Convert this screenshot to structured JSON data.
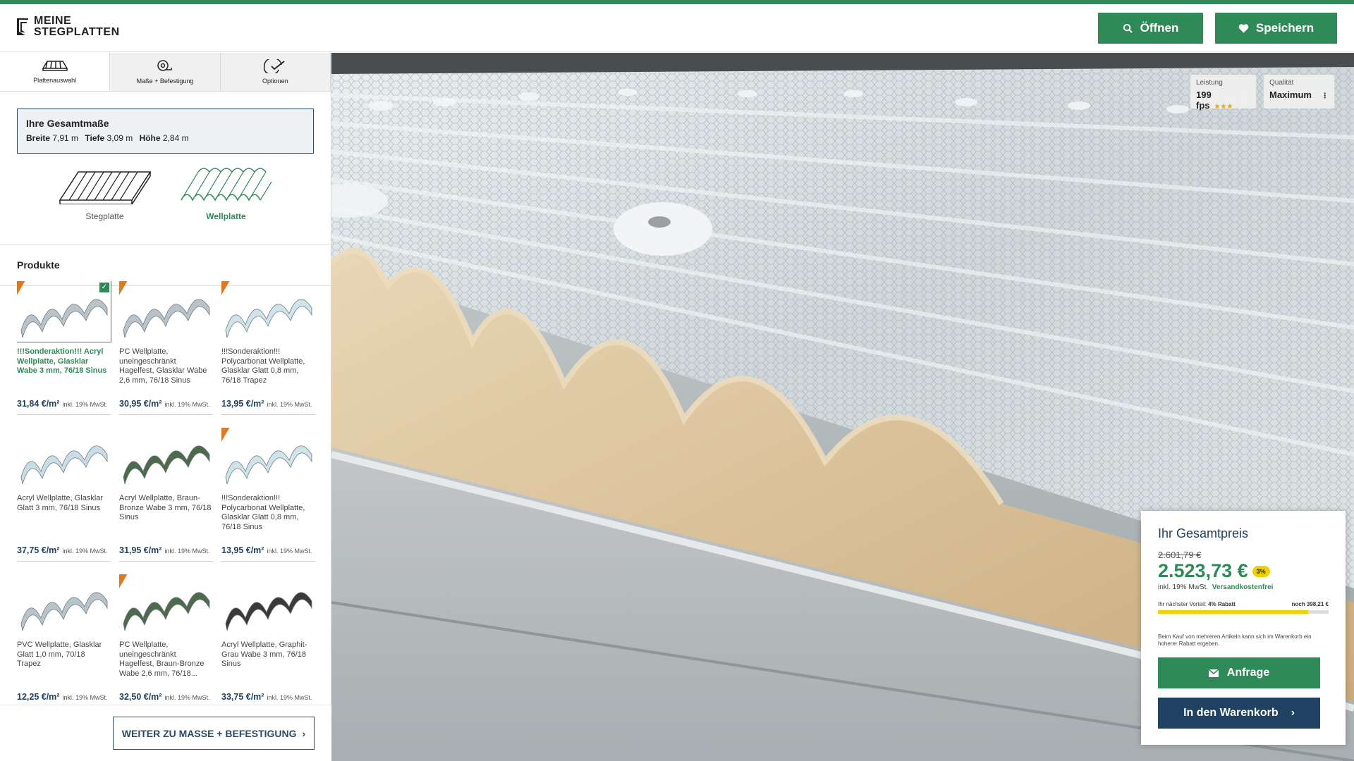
{
  "brand": {
    "line1": "MEINE",
    "line2": "STEGPLATTEN",
    "accent": "#2e8b57",
    "navy": "#1f4262"
  },
  "header": {
    "open_label": "Öffnen",
    "save_label": "Speichern"
  },
  "tabs": [
    {
      "label": "Plattenauswahl",
      "icon": "roof-panel-icon",
      "active": true
    },
    {
      "label": "Maße + Befestigung",
      "icon": "tape-measure-icon",
      "active": false
    },
    {
      "label": "Optionen",
      "icon": "options-check-icon",
      "active": false
    }
  ],
  "dims": {
    "title": "Ihre Gesamtmaße",
    "width_label": "Breite",
    "width_value": "7,91 m",
    "depth_label": "Tiefe",
    "depth_value": "3,09 m",
    "height_label": "Höhe",
    "height_value": "2,84 m"
  },
  "types": [
    {
      "label": "Stegplatte",
      "active": false
    },
    {
      "label": "Wellplatte",
      "active": true
    }
  ],
  "products_title": "Produkte",
  "vat_small": "inkl. 19% MwSt.",
  "products": [
    {
      "name": "!!!Sonderaktion!!! Acryl Wellplatte, Glasklar Wabe 3 mm, 76/18 Sinus",
      "price": "31,84 €/m²",
      "selected": true,
      "sale": true,
      "color": "#b9c3c9"
    },
    {
      "name": "PC Wellplatte, uneingeschränkt Hagelfest, Glasklar Wabe 2,6 mm, 76/18 Sinus",
      "price": "30,95 €/m²",
      "selected": false,
      "sale": true,
      "color": "#b9c3c9"
    },
    {
      "name": "!!!Sonderaktion!!! Polycarbonat Wellplatte, Glasklar Glatt 0,8 mm, 76/18 Trapez",
      "price": "13,95 €/m²",
      "selected": false,
      "sale": true,
      "color": "#cfe3ea"
    },
    {
      "name": "Acryl Wellplatte, Glasklar Glatt 3 mm, 76/18 Sinus",
      "price": "37,75 €/m²",
      "selected": false,
      "sale": false,
      "color": "#c9dde6"
    },
    {
      "name": "Acryl Wellplatte, Braun-Bronze Wabe 3 mm, 76/18 Sinus",
      "price": "31,95 €/m²",
      "selected": false,
      "sale": false,
      "color": "#4d6b4a"
    },
    {
      "name": "!!!Sonderaktion!!! Polycarbonat Wellplatte, Glasklar Glatt 0,8 mm, 76/18 Sinus",
      "price": "13,95 €/m²",
      "selected": false,
      "sale": true,
      "color": "#cfe3ea"
    },
    {
      "name": "PVC Wellplatte, Glasklar Glatt 1,0 mm, 70/18 Trapez",
      "price": "12,25 €/m²",
      "selected": false,
      "sale": false,
      "color": "#b7c4cb"
    },
    {
      "name": "PC Wellplatte, uneingeschränkt Hagelfest, Braun-Bronze Wabe 2,6 mm, 76/18...",
      "price": "32,50 €/m²",
      "selected": false,
      "sale": true,
      "color": "#4d6b4a"
    },
    {
      "name": "Acryl Wellplatte, Graphit-Grau Wabe 3 mm, 76/18 Sinus",
      "price": "33,75 €/m²",
      "selected": false,
      "sale": false,
      "color": "#3a3a3a"
    }
  ],
  "next_button": "WEITER ZU MASSE + BEFESTIGUNG",
  "stats": {
    "perf_label": "Leistung",
    "perf_value": "199 fps",
    "perf_stars": "★★★",
    "quality_label": "Qualität",
    "quality_value": "Maximum"
  },
  "price_panel": {
    "title": "Ihr Gesamtpreis",
    "old_price": "2.601,79 €",
    "new_price": "2.523,73 €",
    "badge": "3%",
    "vat": "inkl. 19% MwSt.",
    "shipping": "Versandkostenfrei",
    "next_advantage_label": "Ihr nächster Vorteil:",
    "next_advantage_value": "4% Rabatt",
    "remaining": "noch 398,21 €",
    "progress": 0.88,
    "note": "Beim Kauf von mehreren Artikeln kann sich im Warenkorb ein hoherer Rabatt ergeben.",
    "request_label": "Anfrage",
    "cart_label": "In den Warenkorb"
  }
}
